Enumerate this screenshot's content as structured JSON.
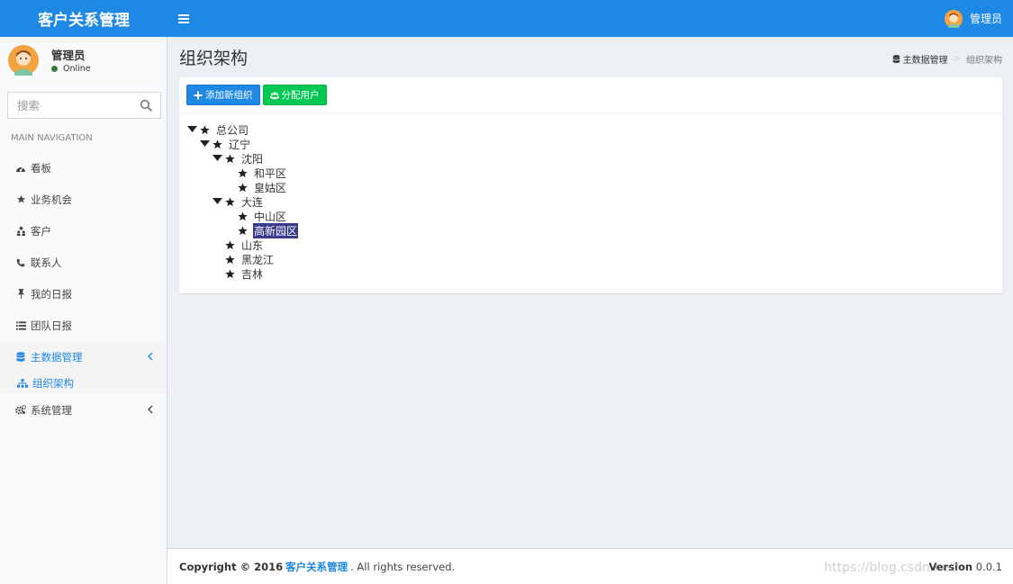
{
  "app": {
    "title": "客户关系管理"
  },
  "header": {
    "user_name": "管理员"
  },
  "sidebar": {
    "user": {
      "name": "管理员",
      "status": "Online"
    },
    "search_placeholder": "搜索",
    "nav_header": "MAIN NAVIGATION",
    "items": [
      {
        "label": "看板",
        "icon": "dashboard-icon"
      },
      {
        "label": "业务机会",
        "icon": "star-icon"
      },
      {
        "label": "客户",
        "icon": "users-icon"
      },
      {
        "label": "联系人",
        "icon": "phone-icon"
      },
      {
        "label": "我的日报",
        "icon": "pin-icon"
      },
      {
        "label": "团队日报",
        "icon": "list-icon"
      },
      {
        "label": "主数据管理",
        "icon": "database-icon"
      },
      {
        "label": "组织架构",
        "icon": "sitemap-icon"
      },
      {
        "label": "系统管理",
        "icon": "gears-icon"
      }
    ]
  },
  "page": {
    "title": "组织架构",
    "breadcrumb": [
      "主数据管理",
      "组织架构"
    ]
  },
  "toolbar": {
    "add_label": "添加新组织",
    "assign_label": "分配用户"
  },
  "tree": [
    "总公司",
    "辽宁",
    "沈阳",
    "和平区",
    "皇姑区",
    "大连",
    "中山区",
    "高新园区",
    "山东",
    "黑龙江",
    "吉林"
  ],
  "footer": {
    "copyright_prefix": "Copyright © 2016",
    "company": "客户关系管理",
    "suffix": ". All rights reserved.",
    "version_label": "Version",
    "version": "0.0.1",
    "watermark": "https://blog.csdn.net/"
  },
  "colors": {
    "primary": "#1e88e5",
    "success": "#00c853",
    "selected_node": "#3a3a8c"
  }
}
